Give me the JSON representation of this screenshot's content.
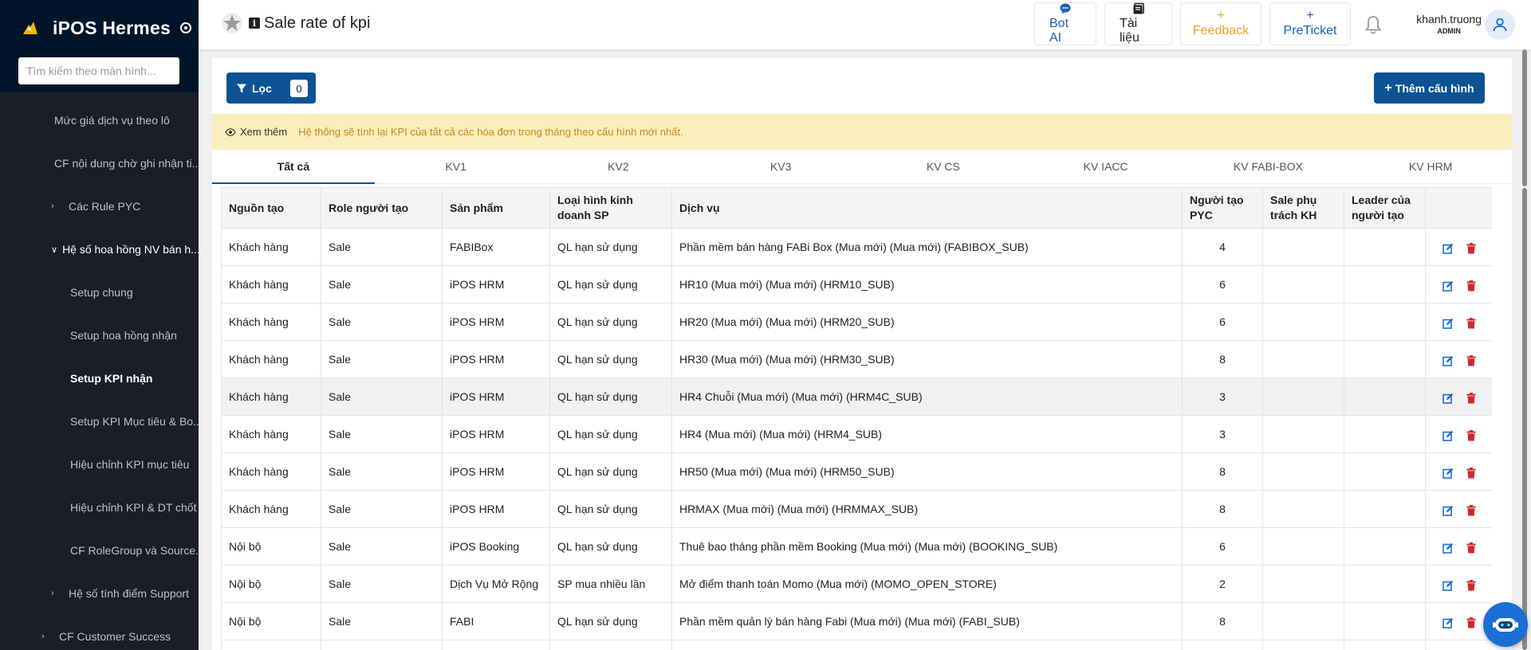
{
  "app": {
    "title": "iPOS Hermes"
  },
  "sidebar": {
    "search_placeholder": "Tìm kiếm theo màn hình...",
    "items": [
      {
        "label": "Mức giá dịch vụ theo lô",
        "level": "l1"
      },
      {
        "label": "CF nội dung chờ ghi nhận ti...",
        "level": "l1"
      },
      {
        "label": "Các Rule PYC",
        "level": "l1c",
        "chevron": "›"
      },
      {
        "label": "Hệ số hoa hồng NV bán h...",
        "level": "l1c",
        "chevron": "⌄",
        "state": "open"
      },
      {
        "label": "Setup chung",
        "level": "l2"
      },
      {
        "label": "Setup hoa hồng nhận",
        "level": "l2"
      },
      {
        "label": "Setup KPI nhận",
        "level": "l2",
        "state": "active"
      },
      {
        "label": "Setup KPI Mục tiêu & Bo...",
        "level": "l2"
      },
      {
        "label": "Hiệu chỉnh KPI mục tiêu",
        "level": "l2"
      },
      {
        "label": "Hiệu chỉnh KPI & DT chốt",
        "level": "l2"
      },
      {
        "label": "CF RoleGroup và Source...",
        "level": "l2"
      },
      {
        "label": "Hệ số tính điểm Support",
        "level": "l1c",
        "chevron": "›"
      },
      {
        "label": "CF Customer Success",
        "level": "l0",
        "chevron": "›"
      }
    ]
  },
  "header": {
    "page_title": "Sale rate of kpi",
    "buttons": {
      "bot_ai": "Bot AI",
      "docs": "Tài liệu",
      "feedback": "Feedback",
      "preticket": "PreTicket"
    },
    "user": {
      "name": "khanh.truong",
      "role": "ADMIN"
    }
  },
  "toolbar": {
    "filter_label": "Lọc",
    "filter_count": "0",
    "add_label": "Thêm cấu hình"
  },
  "notice": {
    "see_more": "Xem thêm",
    "message": "Hệ thống sẽ tính lại KPI của tất cả các hóa đơn trong tháng theo cấu hình mới nhất."
  },
  "tabs": [
    "Tất cả",
    "KV1",
    "KV2",
    "KV3",
    "KV CS",
    "KV IACC",
    "KV FABI-BOX",
    "KV HRM"
  ],
  "active_tab": 0,
  "table": {
    "columns": [
      "Nguồn tạo",
      "Role người tạo",
      "Sản phẩm",
      "Loại hình kinh doanh SP",
      "Dịch vụ",
      "Người tạo PYC",
      "Sale phụ trách KH",
      "Leader của người tạo",
      ""
    ],
    "rows": [
      [
        "Khách hàng",
        "Sale",
        "FABIBox",
        "QL hạn sử dụng",
        "Phần mềm bán hàng FABi Box (Mua mới) (Mua mới) (FABIBOX_SUB)",
        "4",
        "",
        ""
      ],
      [
        "Khách hàng",
        "Sale",
        "iPOS HRM",
        "QL hạn sử dụng",
        "HR10 (Mua mới) (Mua mới) (HRM10_SUB)",
        "6",
        "",
        ""
      ],
      [
        "Khách hàng",
        "Sale",
        "iPOS HRM",
        "QL hạn sử dụng",
        "HR20 (Mua mới) (Mua mới) (HRM20_SUB)",
        "6",
        "",
        ""
      ],
      [
        "Khách hàng",
        "Sale",
        "iPOS HRM",
        "QL hạn sử dụng",
        "HR30 (Mua mới) (Mua mới) (HRM30_SUB)",
        "8",
        "",
        ""
      ],
      [
        "Khách hàng",
        "Sale",
        "iPOS HRM",
        "QL hạn sử dụng",
        "HR4 Chuỗi (Mua mới) (Mua mới) (HRM4C_SUB)",
        "3",
        "",
        ""
      ],
      [
        "Khách hàng",
        "Sale",
        "iPOS HRM",
        "QL hạn sử dụng",
        "HR4 (Mua mới) (Mua mới) (HRM4_SUB)",
        "3",
        "",
        ""
      ],
      [
        "Khách hàng",
        "Sale",
        "iPOS HRM",
        "QL hạn sử dụng",
        "HR50 (Mua mới) (Mua mới) (HRM50_SUB)",
        "8",
        "",
        ""
      ],
      [
        "Khách hàng",
        "Sale",
        "iPOS HRM",
        "QL hạn sử dụng",
        "HRMAX (Mua mới) (Mua mới) (HRMMAX_SUB)",
        "8",
        "",
        ""
      ],
      [
        "Nội bộ",
        "Sale",
        "iPOS Booking",
        "QL hạn sử dụng",
        "Thuê bao tháng phần mềm Booking (Mua mới) (Mua mới) (BOOKING_SUB)",
        "6",
        "",
        ""
      ],
      [
        "Nội bộ",
        "Sale",
        "Dịch Vụ Mở Rộng",
        "SP mua nhiều lần",
        "Mở điểm thanh toán Momo (Mua mới) (MOMO_OPEN_STORE)",
        "2",
        "",
        ""
      ],
      [
        "Nội bộ",
        "Sale",
        "FABI",
        "QL hạn sử dụng",
        "Phần mềm quản lý bán hàng Fabi (Mua mới) (Mua mới) (FABI_SUB)",
        "8",
        "",
        ""
      ],
      [
        "",
        "",
        "",
        "",
        "",
        "",
        "",
        ""
      ]
    ],
    "highlighted_row": 4
  },
  "colors": {
    "primary": "#0b5394",
    "sidebar": "#001529",
    "notice_bg": "#fbeebd",
    "notice_text": "#c8871a",
    "delete": "#d0282e",
    "edit": "#1a6fd4"
  }
}
